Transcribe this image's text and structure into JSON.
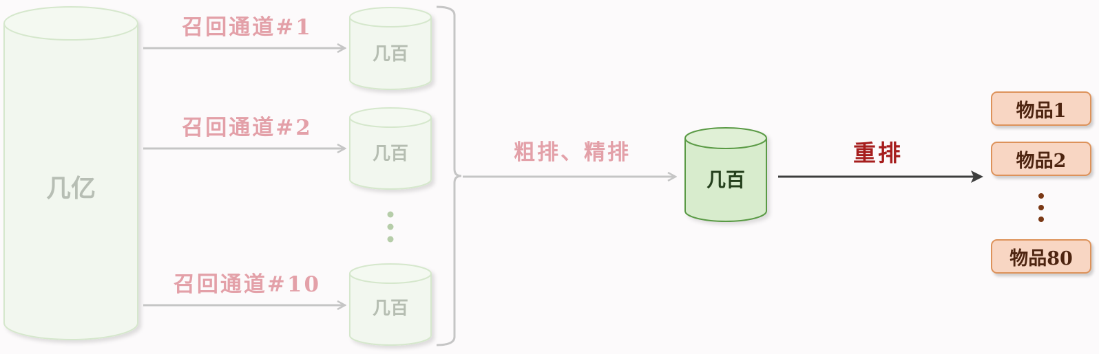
{
  "source": {
    "label": "几亿"
  },
  "channels": [
    {
      "label": "召回通道#1",
      "result": "几百"
    },
    {
      "label": "召回通道#2",
      "result": "几百"
    },
    {
      "label": "召回通道#10",
      "result": "几百"
    }
  ],
  "ranking": {
    "label": "粗排、精排",
    "result": "几百"
  },
  "rerank": {
    "label": "重排"
  },
  "items": [
    "物品1",
    "物品2",
    "物品80"
  ],
  "colors": {
    "faded_cylinder_fill": "#f2f7ef",
    "faded_cylinder_stroke": "#d5e7cc",
    "active_cylinder_fill": "#d8eccd",
    "active_cylinder_stroke": "#5a9a45",
    "faded_label": "#e3a0a8",
    "rerank_label": "#a61d1d",
    "item_fill": "#f8d6c3",
    "item_border": "#dd925a",
    "arrow_faded": "#c5c5c5",
    "arrow_dark": "#3d3d3d",
    "dots_green": "#b6cda9",
    "dots_brown": "#7a3815"
  }
}
